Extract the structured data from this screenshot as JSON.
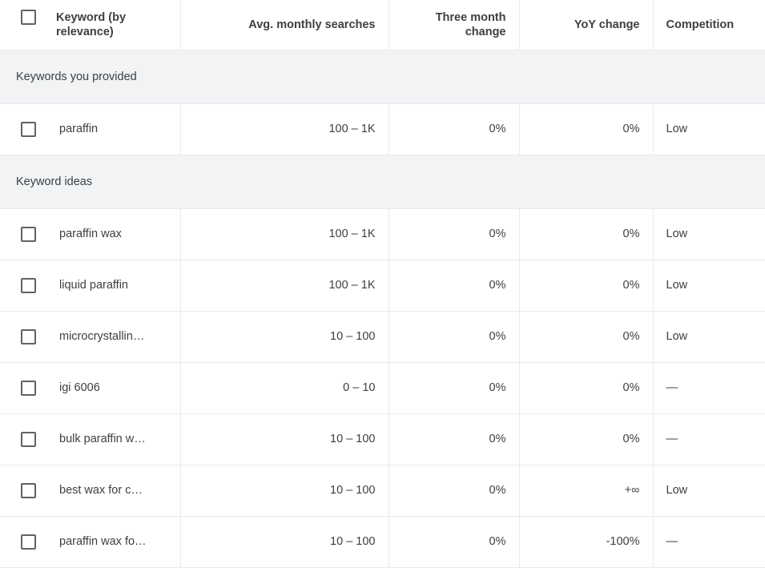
{
  "table": {
    "select_all_checkbox": "select-all",
    "columns": [
      {
        "key": "keyword",
        "label": "Keyword (by relevance)",
        "align": "left"
      },
      {
        "key": "searches",
        "label": "Avg. monthly searches",
        "align": "right"
      },
      {
        "key": "three_month",
        "label": "Three month change",
        "align": "right"
      },
      {
        "key": "yoy",
        "label": "YoY change",
        "align": "right"
      },
      {
        "key": "competition",
        "label": "Competition",
        "align": "left"
      }
    ],
    "sections": [
      {
        "title": "Keywords you provided",
        "rows": [
          {
            "keyword": "paraffin",
            "searches": "100 – 1K",
            "three_month": "0%",
            "yoy": "0%",
            "competition": "Low"
          }
        ]
      },
      {
        "title": "Keyword ideas",
        "rows": [
          {
            "keyword": "paraffin wax",
            "searches": "100 – 1K",
            "three_month": "0%",
            "yoy": "0%",
            "competition": "Low"
          },
          {
            "keyword": "liquid paraffin",
            "searches": "100 – 1K",
            "three_month": "0%",
            "yoy": "0%",
            "competition": "Low"
          },
          {
            "keyword": "microcrystallin…",
            "searches": "10 – 100",
            "three_month": "0%",
            "yoy": "0%",
            "competition": "Low"
          },
          {
            "keyword": "igi 6006",
            "searches": "0 – 10",
            "three_month": "0%",
            "yoy": "0%",
            "competition": "—"
          },
          {
            "keyword": "bulk paraffin w…",
            "searches": "10 – 100",
            "three_month": "0%",
            "yoy": "0%",
            "competition": "—"
          },
          {
            "keyword": "best wax for c…",
            "searches": "10 – 100",
            "three_month": "0%",
            "yoy": "+∞",
            "competition": "Low"
          },
          {
            "keyword": "paraffin wax fo…",
            "searches": "10 – 100",
            "three_month": "0%",
            "yoy": "-100%",
            "competition": "—"
          }
        ]
      }
    ]
  },
  "colors": {
    "section_header_bg": "#f1f3f4",
    "border": "#e8eaed",
    "text": "#3c4043",
    "checkbox_border": "#5f6368"
  }
}
